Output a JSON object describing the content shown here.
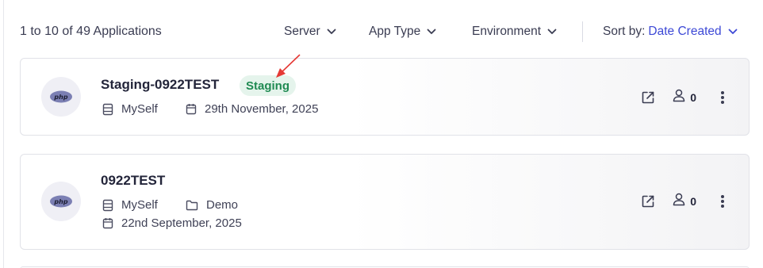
{
  "toolbar": {
    "count_label": "1 to 10 of 49 Applications",
    "filters": [
      {
        "label": "Server",
        "icon": "chevron-down-icon"
      },
      {
        "label": "App Type",
        "icon": "chevron-down-icon"
      },
      {
        "label": "Environment",
        "icon": "chevron-down-icon"
      }
    ],
    "sort": {
      "prefix": "Sort by:",
      "value": "Date Created",
      "icon": "chevron-down-icon"
    }
  },
  "apps": [
    {
      "name": "Staging-0922TEST",
      "logo_text": "php",
      "environment": "Staging",
      "server": "MySelf",
      "created": "29th November, 2025",
      "users": "0"
    },
    {
      "name": "0922TEST",
      "logo_text": "php",
      "server": "MySelf",
      "folder": "Demo",
      "created": "22nd September, 2025",
      "users": "0"
    }
  ],
  "colors": {
    "accent": "#3d49d6",
    "staging_bg": "#e5f4ec",
    "staging_text": "#1f8a52",
    "annotation_arrow": "#e53935"
  }
}
